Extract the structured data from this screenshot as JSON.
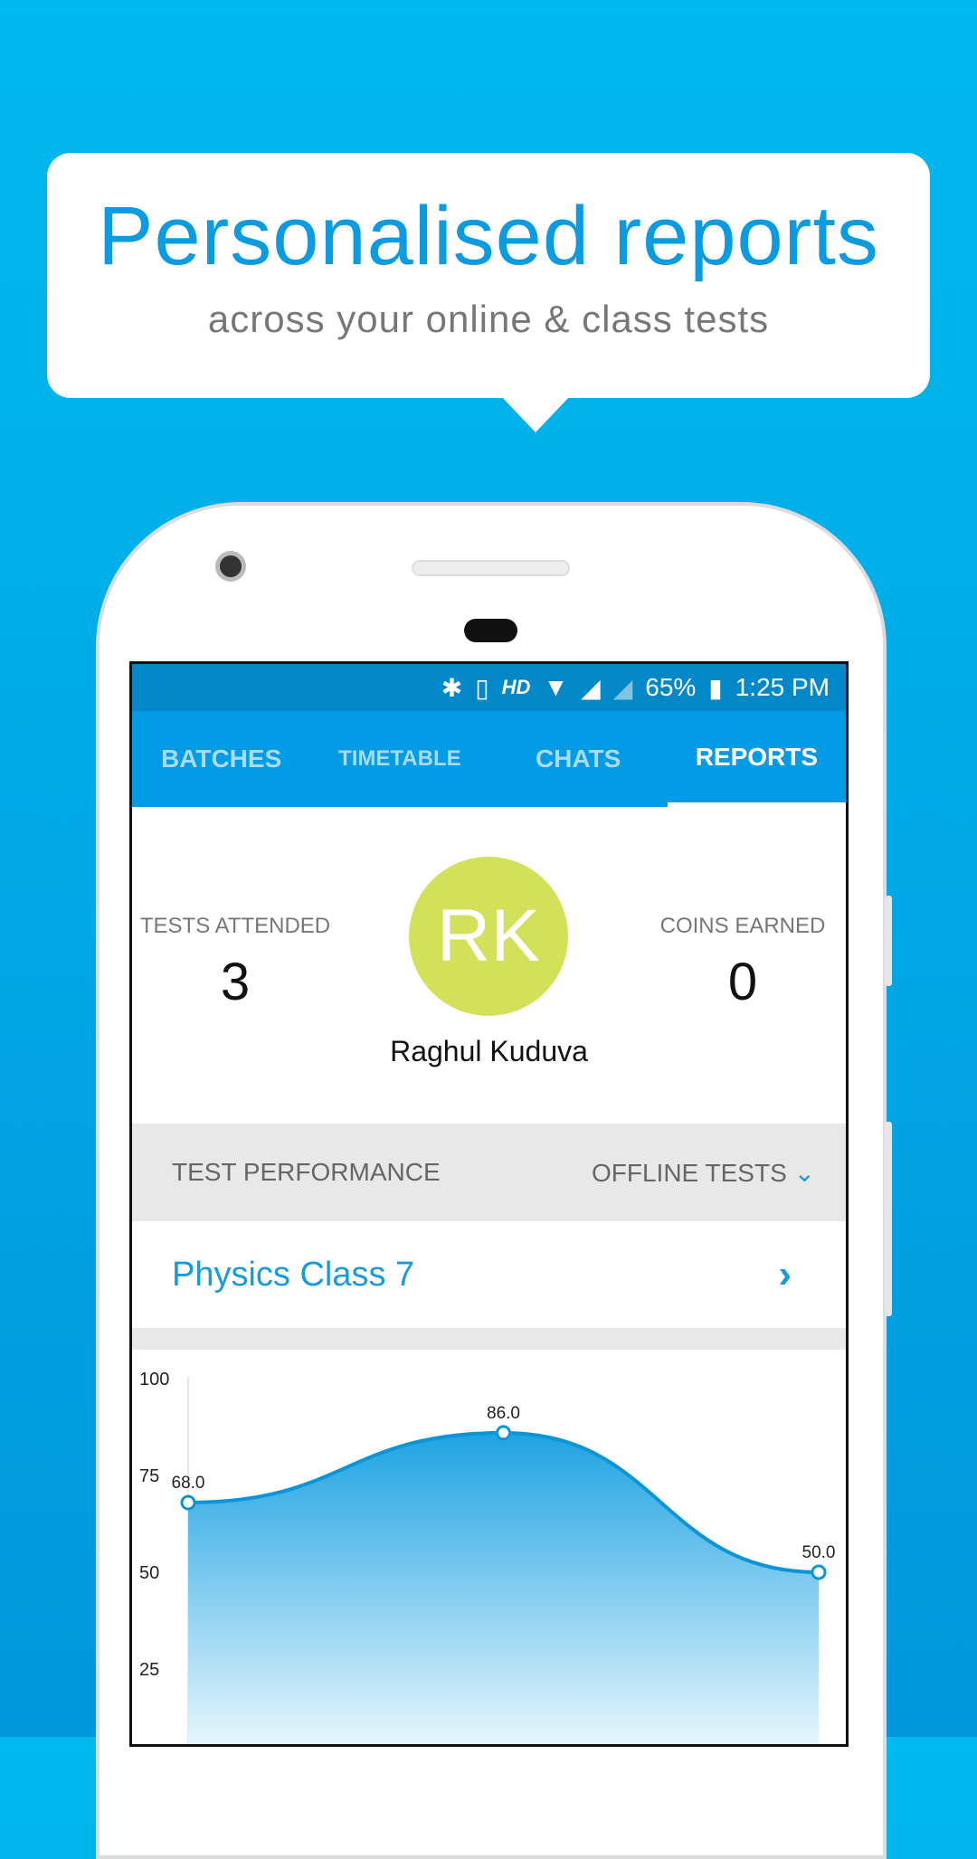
{
  "promo": {
    "headline": "Personalised reports",
    "subheadline": "across your online & class tests"
  },
  "status_bar": {
    "icons": [
      "bluetooth-icon",
      "vibrate-icon",
      "hd-icon",
      "data-arrows-icon",
      "wifi-icon",
      "signal-icon",
      "signal-empty-icon",
      "battery-icon"
    ],
    "hd": "HD",
    "battery": "65%",
    "time": "1:25 PM"
  },
  "tabs": [
    {
      "label": "BATCHES"
    },
    {
      "label": "TIMETABLE"
    },
    {
      "label": "CHATS"
    },
    {
      "label": "REPORTS",
      "active": true
    }
  ],
  "profile": {
    "tests_attended_label": "TESTS ATTENDED",
    "tests_attended": "3",
    "coins_label": "COINS EARNED",
    "coins": "0",
    "initials": "RK",
    "name": "Raghul Kuduva",
    "avatar_color": "#d3e15a"
  },
  "performance": {
    "title": "TEST PERFORMANCE",
    "filter": "OFFLINE TESTS"
  },
  "batch": {
    "name": "Physics Class 7"
  },
  "colors": {
    "accent": "#039be5",
    "status": "#0288c8",
    "link": "#1a9ad8"
  },
  "chart_data": {
    "type": "area",
    "smooth": true,
    "values": [
      68.0,
      86.0,
      50.0
    ],
    "labels": [
      "68.0",
      "86.0",
      "50.0"
    ],
    "yticks": [
      "100",
      "75",
      "50",
      "25"
    ],
    "ylim": [
      0,
      100
    ],
    "grid": false
  }
}
